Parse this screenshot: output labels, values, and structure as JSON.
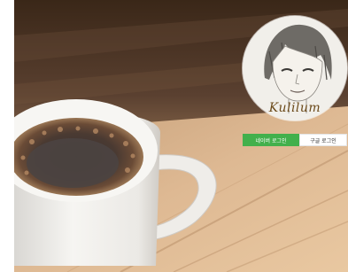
{
  "profile": {
    "signature_text": "Kulilum"
  },
  "login": {
    "naver_label": "네이버 로그인",
    "google_label": "구글 로그인"
  },
  "colors": {
    "naver_green": "#42b04c",
    "google_bg": "#ffffff",
    "wood_dark": "#4a3422",
    "wood_light": "#d7b48a"
  }
}
